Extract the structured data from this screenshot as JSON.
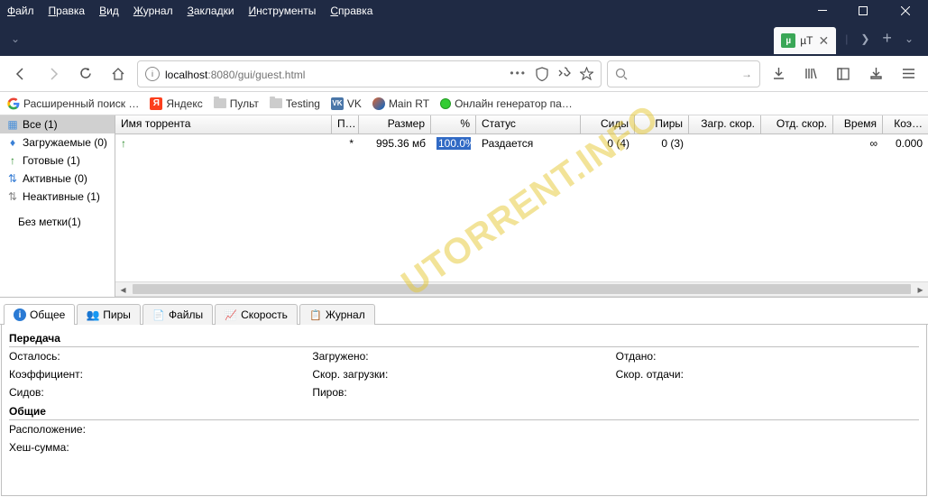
{
  "menubar": [
    "Файл",
    "Правка",
    "Вид",
    "Журнал",
    "Закладки",
    "Инструменты",
    "Справка"
  ],
  "tab": {
    "title": "µT"
  },
  "url": {
    "host": "localhost",
    "port": ":8080",
    "path": "/gui/guest.html"
  },
  "bookmarks": [
    {
      "label": "Расширенный поиск …",
      "icon": "google"
    },
    {
      "label": "Яндекс",
      "icon": "yandex"
    },
    {
      "label": "Пульт",
      "icon": "folder"
    },
    {
      "label": "Testing",
      "icon": "folder"
    },
    {
      "label": "VK",
      "icon": "vk"
    },
    {
      "label": "Main RT",
      "icon": "rt"
    },
    {
      "label": "Онлайн генератор па…",
      "icon": "green"
    }
  ],
  "sidebar": [
    {
      "label": "Все (1)",
      "selected": true,
      "icon": "all"
    },
    {
      "label": "Загружаемые (0)",
      "icon": "down"
    },
    {
      "label": "Готовые (1)",
      "icon": "up"
    },
    {
      "label": "Активные (0)",
      "icon": "active"
    },
    {
      "label": "Неактивные (1)",
      "icon": "inactive"
    },
    {
      "label": "Без метки(1)",
      "noicon": true
    }
  ],
  "columns": [
    "Имя торрента",
    "П…",
    "Размер",
    "%",
    "Статус",
    "Сиды",
    "Пиры",
    "Загр. скор.",
    "Отд. скор.",
    "Время",
    "Коэ…"
  ],
  "row": {
    "name": "",
    "p": "*",
    "size": "995.36 мб",
    "pct": "100.0%",
    "status": "Раздается",
    "seeds": "0 (4)",
    "peers": "0 (3)",
    "dl": "",
    "ul": "",
    "time": "∞",
    "ratio": "0.000"
  },
  "dtabs": [
    "Общее",
    "Пиры",
    "Файлы",
    "Скорость",
    "Журнал"
  ],
  "details": {
    "sect1": "Передача",
    "remaining": "Осталось:",
    "downloaded": "Загружено:",
    "uploaded": "Отдано:",
    "ratio": "Коэффициент:",
    "dlspeed": "Скор. загрузки:",
    "ulspeed": "Скор. отдачи:",
    "seeds": "Сидов:",
    "peers": "Пиров:",
    "sect2": "Общие",
    "location": "Расположение:",
    "hash": "Хеш-сумма:"
  },
  "watermark": "UTORRENT.INFO"
}
